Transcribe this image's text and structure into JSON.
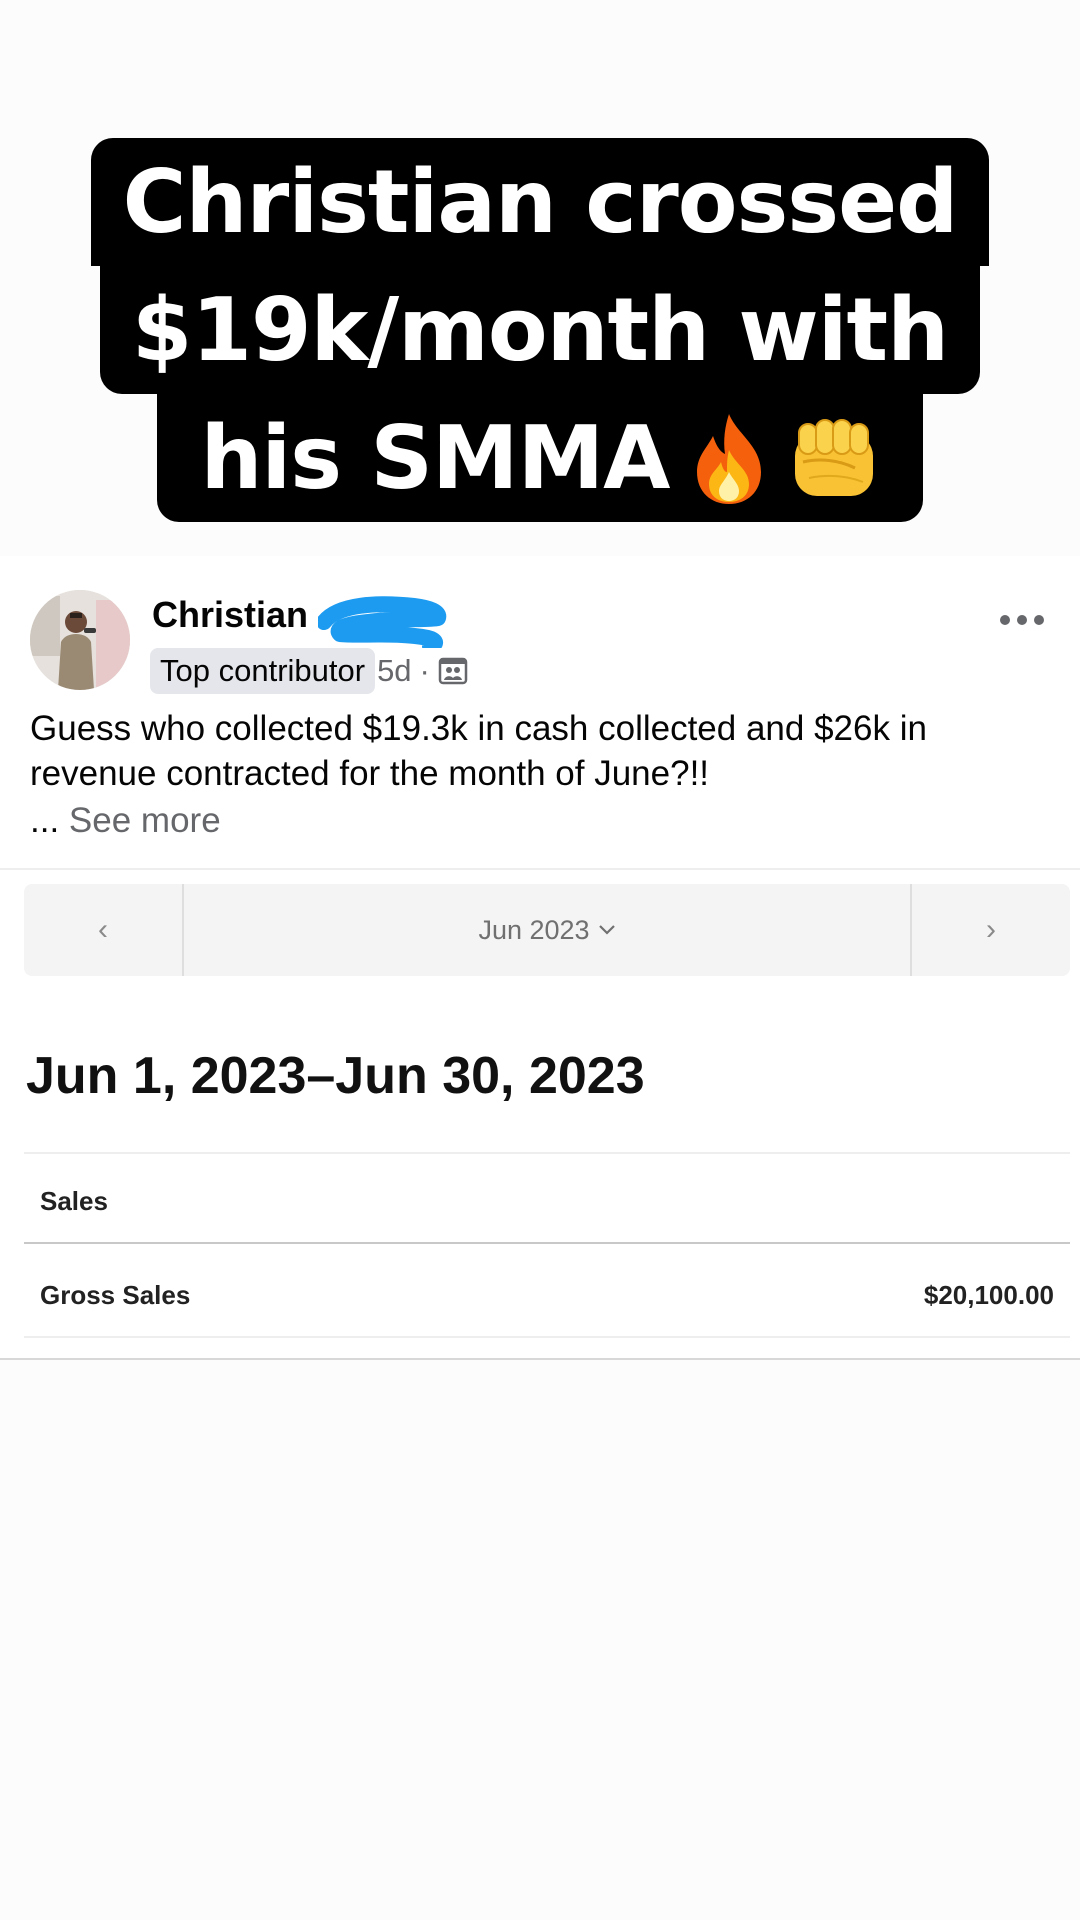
{
  "caption": {
    "lines": [
      "Christian crossed",
      "$19k/month with",
      "his SMMA"
    ],
    "emojis": [
      "fire-emoji",
      "oncoming-fist-emoji"
    ]
  },
  "post": {
    "author": "Christian",
    "badge": "Top contributor",
    "time": "5d",
    "separator": "·",
    "audience_icon": "group-icon",
    "body": "Guess who collected $19.3k in cash collected and $26k in revenue contracted for the month of June?!!",
    "ellipsis": "...",
    "see_more": "See more",
    "more_icon": "more-horizontal-icon"
  },
  "report": {
    "prev_glyph": "‹",
    "next_glyph": "›",
    "month": "Jun 2023",
    "date_range": "Jun 1, 2023–Jun 30, 2023",
    "section": "Sales",
    "rows": [
      {
        "label": "Gross Sales",
        "value": "$20,100.00"
      }
    ]
  },
  "colors": {
    "caption_bg": "#000000",
    "caption_text": "#ffffff",
    "badge_bg": "#e4e6eb",
    "secondary_text": "#65676b",
    "redaction": "#1d9bf0"
  }
}
